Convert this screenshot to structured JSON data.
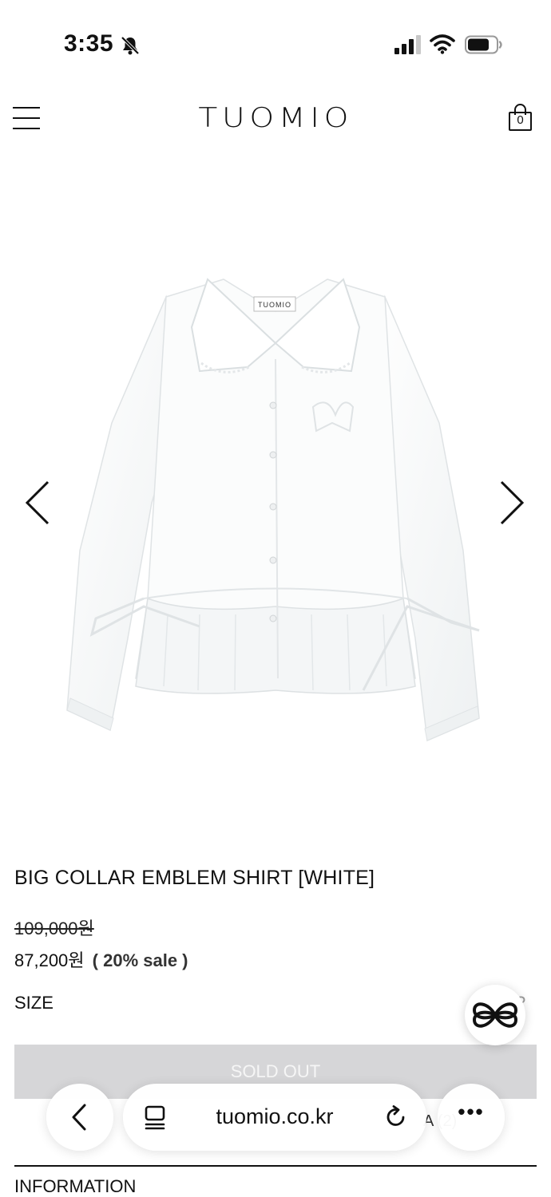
{
  "status_bar": {
    "time": "3:35",
    "icons": [
      "bell-slash-icon",
      "signal-icon",
      "wifi-icon",
      "battery-icon"
    ]
  },
  "header": {
    "logo": "TUOMIO",
    "cart_count": "0",
    "icons": [
      "menu-icon",
      "cart-icon"
    ]
  },
  "gallery": {
    "prev_icon": "chevron-left-icon",
    "next_icon": "chevron-right-icon",
    "image_label": "TUOMIO"
  },
  "product": {
    "title": "BIG COLLAR EMBLEM SHIRT [WHITE]",
    "original_price": "109,000원",
    "sale_price": "87,200원",
    "discount": "( 20% sale )",
    "size_label": "SIZE",
    "size_help": "?",
    "sold_out_label": "SOLD OUT",
    "review_fragment": "A (2)",
    "info_heading": "INFORMATION"
  },
  "browser": {
    "url": "tuomio.co.kr",
    "icons": [
      "back-icon",
      "tabs-icon",
      "reload-icon",
      "more-icon"
    ]
  },
  "colors": {
    "sold_out_bg": "#d6d6d8",
    "text": "#111111"
  }
}
